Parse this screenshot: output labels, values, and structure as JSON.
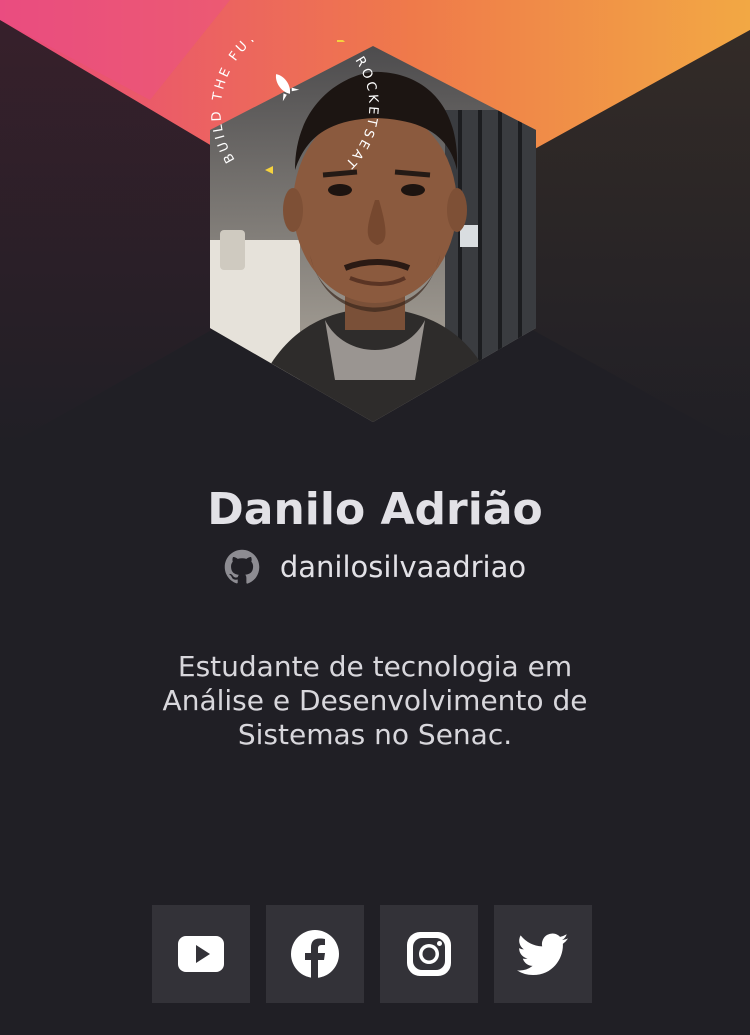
{
  "colors": {
    "background": "#201f25",
    "gradient_start": "#e8497a",
    "gradient_mid": "#ef7a4a",
    "gradient_end": "#f2a844",
    "text": "#e2e1e6",
    "button_bg": "#333238"
  },
  "badge": {
    "text_arc_1": "BUILD THE FUTURE",
    "text_arc_2": "ROCKETSEAT"
  },
  "profile": {
    "name": "Danilo Adrião",
    "github_icon": "github-icon",
    "github_handle": "danilosilvaadriao",
    "bio": "Estudante de tecnologia em\nAnálise e Desenvolvimento de\nSistemas no Senac."
  },
  "social_links": [
    {
      "name": "youtube",
      "icon": "youtube-icon"
    },
    {
      "name": "facebook",
      "icon": "facebook-icon"
    },
    {
      "name": "instagram",
      "icon": "instagram-icon"
    },
    {
      "name": "twitter",
      "icon": "twitter-icon"
    }
  ]
}
